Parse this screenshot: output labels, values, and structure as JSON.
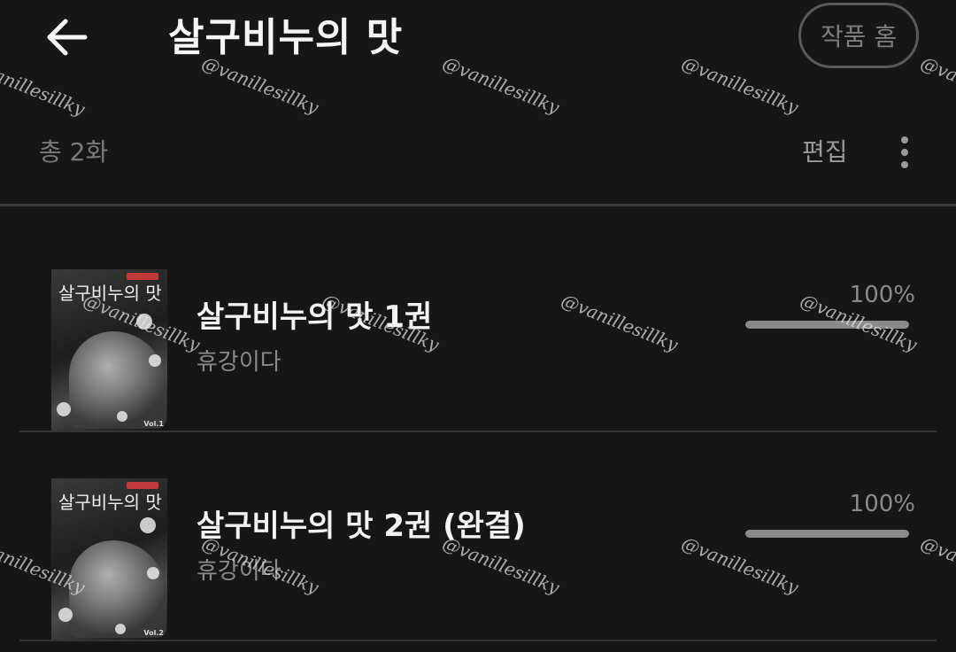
{
  "header": {
    "back_icon": "arrow-left-icon",
    "title": "살구비누의 맛",
    "home_button_label": "작품 홈"
  },
  "subbar": {
    "count_label": "총 2화",
    "edit_label": "편집",
    "more_icon": "more-vertical-icon"
  },
  "books": [
    {
      "title": "살구비누의 맛 1권",
      "author": "휴강이다",
      "progress_label": "100%",
      "progress": 1.0,
      "cover_title": "살구비누의 맛",
      "cover_volume": "Vol.1"
    },
    {
      "title": "살구비누의 맛 2권 (완결)",
      "author": "휴강이다",
      "progress_label": "100%",
      "progress": 1.0,
      "cover_title": "살구비누의 맛",
      "cover_volume": "Vol.2"
    }
  ],
  "watermark_text": "@vanillesillky",
  "colors": {
    "background": "#161616",
    "text_primary": "#f2f2f2",
    "text_secondary": "#8a8a8a",
    "progress_fill": "#8a8a8a"
  }
}
